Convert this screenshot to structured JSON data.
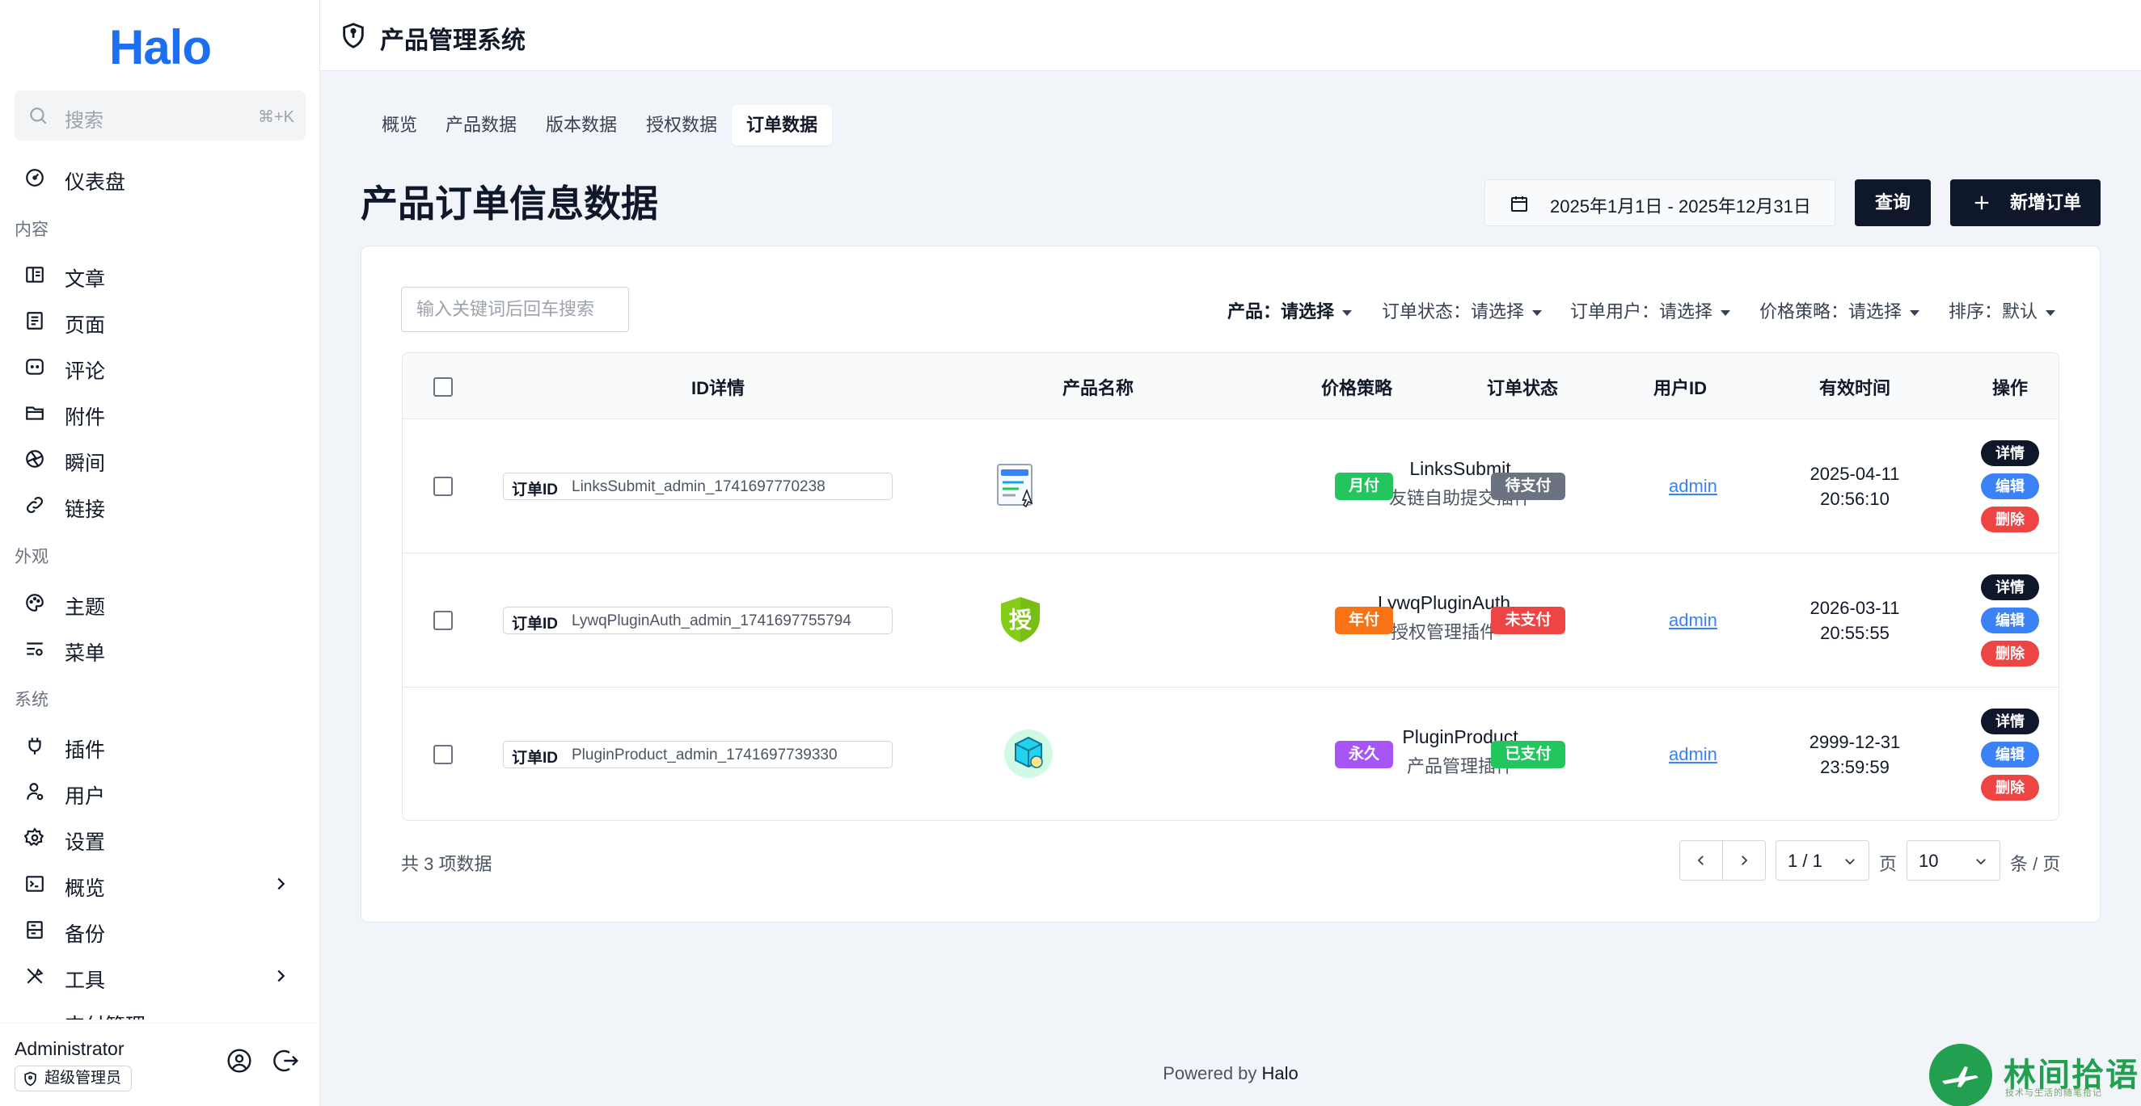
{
  "app": {
    "logo": "Halo",
    "header_title": "产品管理系统"
  },
  "search": {
    "placeholder": "搜索",
    "shortcut": "⌘+K"
  },
  "sidebar": {
    "dashboard": "仪表盘",
    "groups": {
      "content": "内容",
      "appearance": "外观",
      "system": "系统"
    },
    "items": {
      "posts": "文章",
      "pages": "页面",
      "comments": "评论",
      "attachments": "附件",
      "moments": "瞬间",
      "links": "链接",
      "themes": "主题",
      "menus": "菜单",
      "plugins": "插件",
      "users": "用户",
      "settings": "设置",
      "overview": "概览",
      "backup": "备份",
      "tools": "工具",
      "cut_off": "支付管理"
    },
    "user": {
      "name": "Administrator",
      "role": "超级管理员"
    }
  },
  "tabs": [
    {
      "label": "概览"
    },
    {
      "label": "产品数据"
    },
    {
      "label": "版本数据"
    },
    {
      "label": "授权数据"
    },
    {
      "label": "订单数据",
      "active": true
    }
  ],
  "page": {
    "title": "产品订单信息数据",
    "date_range": "2025年1月1日 - 2025年12月31日",
    "query_button": "查询",
    "add_button": "新增订单"
  },
  "filters": {
    "keyword_placeholder": "输入关键词后回车搜索",
    "product_label": "产品：",
    "product_value": "请选择",
    "status_label": "订单状态：",
    "status_value": "请选择",
    "user_label": "订单用户：",
    "user_value": "请选择",
    "price_label": "价格策略：",
    "price_value": "请选择",
    "sort_label": "排序：",
    "sort_value": "默认"
  },
  "table": {
    "headers": {
      "id": "ID详情",
      "product": "产品名称",
      "price": "价格策略",
      "status": "订单状态",
      "user": "用户ID",
      "valid": "有效时间",
      "actions": "操作"
    },
    "order_id_label": "订单ID",
    "actions": {
      "detail": "详情",
      "edit": "编辑",
      "delete": "删除"
    },
    "rows": [
      {
        "order_id": "LinksSubmit_admin_1741697770238",
        "product_name": "LinksSubmit",
        "product_desc": "友链自助提交插件",
        "price": "月付",
        "price_color": "#22c55e",
        "status": "待支付",
        "status_color": "#6b7280",
        "user": "admin",
        "time_date": "2025-04-11",
        "time_clock": "20:56:10",
        "icon": "links-submit-icon"
      },
      {
        "order_id": "LywqPluginAuth_admin_1741697755794",
        "product_name": "LywqPluginAuth",
        "product_desc": "授权管理插件",
        "price": "年付",
        "price_color": "#f97316",
        "status": "未支付",
        "status_color": "#ef4444",
        "user": "admin",
        "time_date": "2026-03-11",
        "time_clock": "20:55:55",
        "icon": "auth-shield-icon",
        "icon_text": "授"
      },
      {
        "order_id": "PluginProduct_admin_1741697739330",
        "product_name": "PluginProduct",
        "product_desc": "产品管理插件",
        "price": "永久",
        "price_color": "#a855f7",
        "status": "已支付",
        "status_color": "#22c55e",
        "user": "admin",
        "time_date": "2999-12-31",
        "time_clock": "23:59:59",
        "icon": "product-box-icon"
      }
    ]
  },
  "pagination": {
    "total": "共 3 项数据",
    "page": "1 / 1",
    "page_unit": "页",
    "size": "10",
    "size_unit": "条 / 页"
  },
  "footer": {
    "prefix": "Powered by",
    "brand": "Halo"
  },
  "watermark": {
    "text": "林间拾语",
    "sub": "技术与生活的随笔拾记"
  },
  "colors": {
    "brand": "#1d6ff2",
    "dark": "#0f172a",
    "link": "#3b82f6",
    "danger": "#ef4444",
    "detail": "#0f172a",
    "edit": "#3b82f6"
  }
}
